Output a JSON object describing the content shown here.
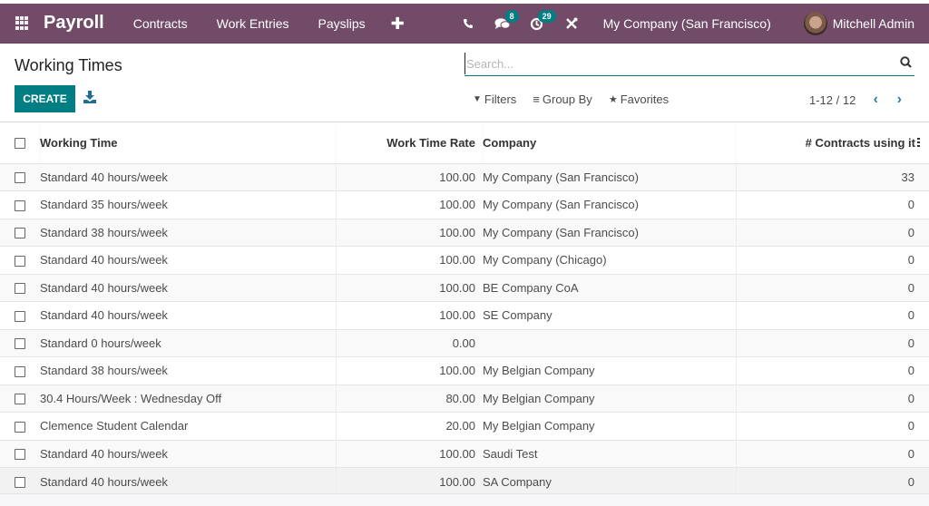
{
  "navbar": {
    "app_name": "Payroll",
    "menu": [
      {
        "label": "Contracts"
      },
      {
        "label": "Work Entries"
      },
      {
        "label": "Payslips"
      }
    ],
    "add_icon": "plus-icon",
    "systray": {
      "phone_icon": "phone-icon",
      "messages_icon": "chat-bubbles-icon",
      "messages_count": "8",
      "activities_icon": "clock-icon",
      "activities_count": "29",
      "debug_icon": "tools-icon"
    },
    "company": "My Company (San Francisco)",
    "user": "Mitchell Admin"
  },
  "control_panel": {
    "title": "Working Times",
    "create_label": "CREATE",
    "download_icon": "download-icon",
    "search": {
      "placeholder": "Search...",
      "value": ""
    },
    "filters_label": "Filters",
    "group_by_label": "Group By",
    "favorites_label": "Favorites",
    "pager": "1-12 / 12"
  },
  "table": {
    "columns": {
      "name": "Working Time",
      "rate": "Work Time Rate",
      "company": "Company",
      "contracts": "# Contracts using it"
    },
    "rows": [
      {
        "name": "Standard 40 hours/week",
        "rate": "100.00",
        "company": "My Company (San Francisco)",
        "contracts": "33"
      },
      {
        "name": "Standard 35 hours/week",
        "rate": "100.00",
        "company": "My Company (San Francisco)",
        "contracts": "0"
      },
      {
        "name": "Standard 38 hours/week",
        "rate": "100.00",
        "company": "My Company (San Francisco)",
        "contracts": "0"
      },
      {
        "name": "Standard 40 hours/week",
        "rate": "100.00",
        "company": "My Company (Chicago)",
        "contracts": "0"
      },
      {
        "name": "Standard 40 hours/week",
        "rate": "100.00",
        "company": "BE Company CoA",
        "contracts": "0"
      },
      {
        "name": "Standard 40 hours/week",
        "rate": "100.00",
        "company": "SE Company",
        "contracts": "0"
      },
      {
        "name": "Standard 0 hours/week",
        "rate": "0.00",
        "company": "",
        "contracts": "0"
      },
      {
        "name": "Standard 38 hours/week",
        "rate": "100.00",
        "company": "My Belgian Company",
        "contracts": "0"
      },
      {
        "name": "30.4 Hours/Week : Wednesday Off",
        "rate": "80.00",
        "company": "My Belgian Company",
        "contracts": "0"
      },
      {
        "name": "Clemence Student Calendar",
        "rate": "20.00",
        "company": "My Belgian Company",
        "contracts": "0"
      },
      {
        "name": "Standard 40 hours/week",
        "rate": "100.00",
        "company": "Saudi Test",
        "contracts": "0"
      },
      {
        "name": "Standard 40 hours/week",
        "rate": "100.00",
        "company": "SA Company",
        "contracts": "0"
      }
    ]
  },
  "colors": {
    "navbar": "#714b67",
    "primary": "#017e84",
    "pager_arrows": "#2a7ea0"
  }
}
